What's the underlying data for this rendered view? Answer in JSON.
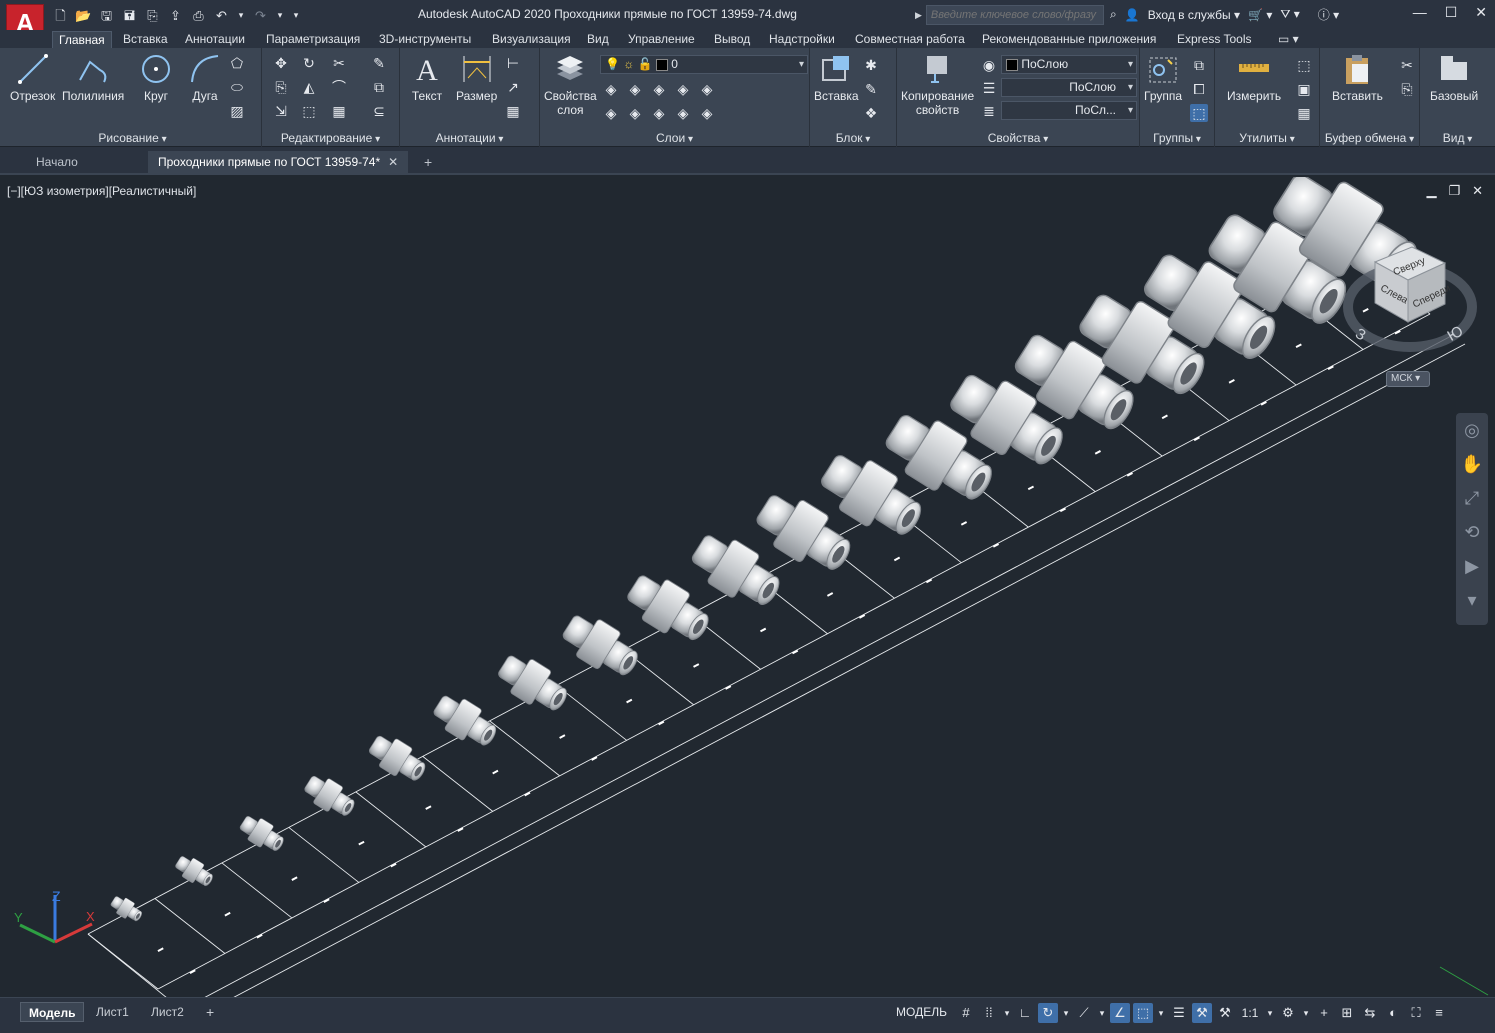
{
  "app": {
    "title": "Autodesk AutoCAD 2020   Проходники прямые по ГОСТ 13959-74.dwg",
    "logo_letter": "A"
  },
  "search": {
    "placeholder": "Введите ключевое слово/фразу"
  },
  "account": {
    "signin_label": "Вход в службы"
  },
  "ribbon_tabs": [
    "Главная",
    "Вставка",
    "Аннотации",
    "Параметризация",
    "3D-инструменты",
    "Визуализация",
    "Вид",
    "Управление",
    "Вывод",
    "Надстройки",
    "Совместная работа",
    "Рекомендованные приложения",
    "Express Tools"
  ],
  "ribbon": {
    "draw": {
      "title": "Рисование",
      "line": "Отрезок",
      "polyline": "Полилиния",
      "circle": "Круг",
      "arc": "Дуга"
    },
    "modify": {
      "title": "Редактирование"
    },
    "annotation": {
      "title": "Аннотации",
      "text": "Текст",
      "dimension": "Размер"
    },
    "layers": {
      "title": "Слои",
      "layer_props_1": "Свойства",
      "layer_props_2": "слоя",
      "current_layer": "0"
    },
    "block": {
      "title": "Блок",
      "insert": "Вставка"
    },
    "properties": {
      "title": "Свойства",
      "match_1": "Копирование",
      "match_2": "свойств",
      "color": "ПоСлою",
      "linetype": "ПоСлою",
      "lineweight": "ПоСл..."
    },
    "groups": {
      "title": "Группы",
      "group": "Группа"
    },
    "utilities": {
      "title": "Утилиты",
      "measure": "Измерить"
    },
    "clipboard": {
      "title": "Буфер обмена",
      "paste": "Вставить"
    },
    "view": {
      "title": "Вид",
      "base": "Базовый"
    }
  },
  "file_tabs": {
    "start": "Начало",
    "active": "Проходники прямые по ГОСТ 13959-74*"
  },
  "viewport": {
    "label": "[−][ЮЗ изометрия][Реалистичный]",
    "viewcube": {
      "top": "Сверху",
      "left": "Слева",
      "front": "Спереди",
      "south": "Ю",
      "west": "З"
    },
    "ucs": "МСК",
    "axes": {
      "x": "X",
      "y": "Y",
      "z": "Z"
    },
    "fitting_count": 19
  },
  "status": {
    "layout_tabs": [
      "Модель",
      "Лист1",
      "Лист2"
    ],
    "model_label": "МОДЕЛЬ",
    "scale": "1:1"
  },
  "colors": {
    "background": "#212830",
    "ribbon": "#3b4553",
    "titlebar": "#2b3340",
    "accent_red": "#c8232c",
    "status_on": "#3f6fa8"
  }
}
